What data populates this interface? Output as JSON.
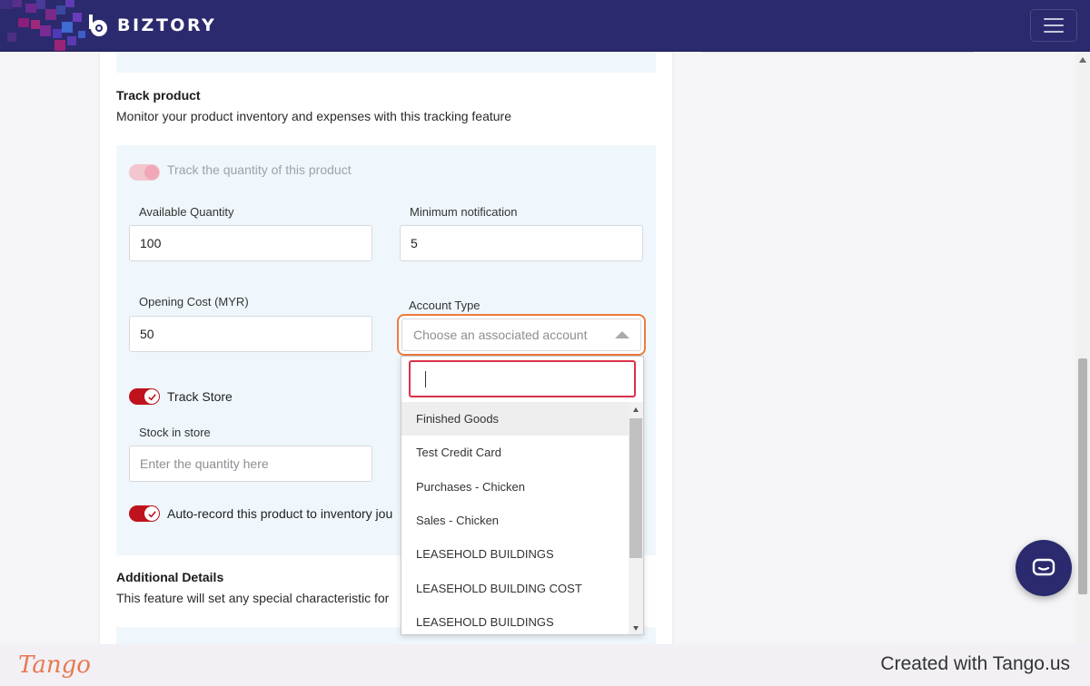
{
  "navbar": {
    "brand": "BIZTORY",
    "menu_icon": "hamburger-icon"
  },
  "track_product": {
    "title": "Track product",
    "description": "Monitor your product inventory and expenses with this tracking feature",
    "track_quantity_label": "Track the quantity of this product",
    "available_quantity_label": "Available Quantity",
    "available_quantity_value": "100",
    "minimum_notification_label": "Minimum notification",
    "minimum_notification_value": "5",
    "opening_cost_label": "Opening Cost (MYR)",
    "opening_cost_value": "50",
    "account_type_label": "Account Type",
    "account_type_placeholder": "Choose an associated account",
    "track_store_label": "Track Store",
    "stock_in_store_label": "Stock in store",
    "stock_in_store_placeholder": "Enter the quantity here",
    "auto_record_label": "Auto-record this product to inventory jou"
  },
  "account_dropdown": {
    "search_value": "",
    "options": [
      "Finished Goods",
      "Test Credit Card",
      "Purchases - Chicken",
      "Sales - Chicken",
      "LEASEHOLD BUILDINGS",
      "LEASEHOLD BUILDING COST",
      "LEASEHOLD BUILDINGS"
    ]
  },
  "additional_details": {
    "title": "Additional Details",
    "description": "This feature will set any special characteristic for"
  },
  "chat": {
    "icon": "chat-icon"
  },
  "footer": {
    "logo": "Tango",
    "created_with": "Created with Tango.us"
  },
  "colors": {
    "navbar": "#2b2a6e",
    "toggle_on": "#c0121c",
    "focus_ring": "#ef7b3b",
    "search_border": "#d9314a",
    "panel_bg": "#eff7fc",
    "tango_orange": "#e8794f"
  }
}
